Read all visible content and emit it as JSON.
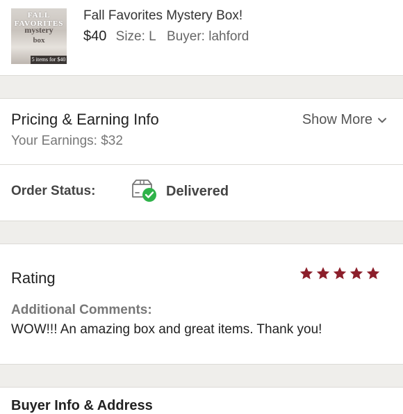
{
  "listing": {
    "thumbnail": {
      "text_top": "FALL FAVORITES",
      "text_mid": "mystery",
      "text_low": "box",
      "text_tag": "5 items for $40"
    },
    "title": "Fall Favorites Mystery Box!",
    "price": "$40",
    "size": "Size: L",
    "buyer": "Buyer: lahford"
  },
  "pricing": {
    "title": "Pricing & Earning Info",
    "earnings": "Your Earnings: $32",
    "show_more": "Show More",
    "show_more_icon": "chevron-down-icon"
  },
  "order_status": {
    "label": "Order Status:",
    "value": "Delivered",
    "icon": "package-delivered-icon",
    "icon_color": "#2fb34a"
  },
  "rating": {
    "title": "Rating",
    "stars": 5,
    "max_stars": 5,
    "star_color": "#8c1f2b",
    "comments_label": "Additional Comments:",
    "comments": "WOW!!! An amazing box and great items. Thank you!"
  },
  "next_section": {
    "heading": "Buyer Info & Address"
  },
  "colors": {
    "divider": "#efeeeb",
    "text_primary": "#222222",
    "text_secondary": "#777777"
  }
}
